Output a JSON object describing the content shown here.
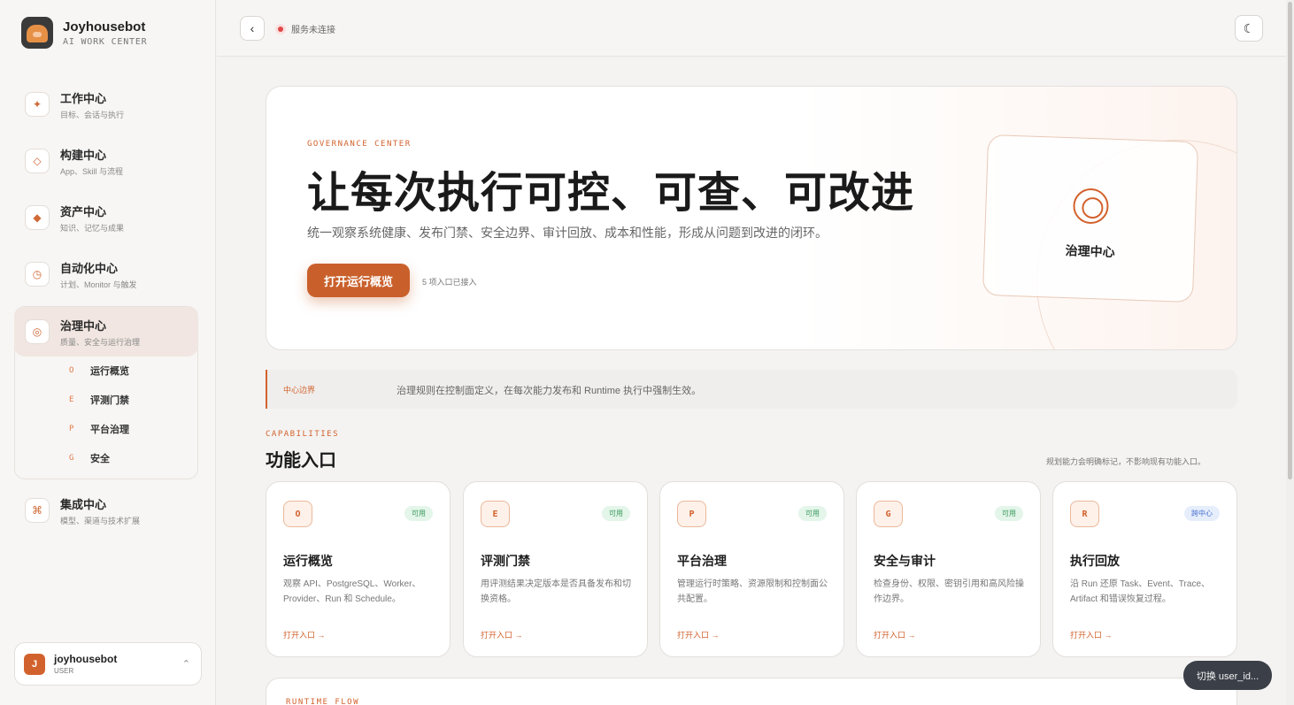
{
  "brand": {
    "name": "Joyhousebot",
    "subtitle": "AI WORK CENTER"
  },
  "sidebar": {
    "items": [
      {
        "title": "工作中心",
        "subtitle": "目标、会话与执行",
        "icon": "sparkle-icon",
        "glyph": "✦"
      },
      {
        "title": "构建中心",
        "subtitle": "App、Skill 与流程",
        "icon": "diamond-outline-icon",
        "glyph": "◇"
      },
      {
        "title": "资产中心",
        "subtitle": "知识、记忆与成果",
        "icon": "diamond-filled-icon",
        "glyph": "◆"
      },
      {
        "title": "自动化中心",
        "subtitle": "计划、Monitor 与触发",
        "icon": "clock-icon",
        "glyph": "◷"
      },
      {
        "title": "治理中心",
        "subtitle": "质量、安全与运行治理",
        "icon": "target-icon",
        "glyph": "◎"
      },
      {
        "title": "集成中心",
        "subtitle": "模型、渠道与技术扩展",
        "icon": "command-icon",
        "glyph": "⌘"
      }
    ],
    "subitems": [
      {
        "key": "O",
        "label": "运行概览"
      },
      {
        "key": "E",
        "label": "评测门禁"
      },
      {
        "key": "P",
        "label": "平台治理"
      },
      {
        "key": "G",
        "label": "安全"
      }
    ]
  },
  "user": {
    "initial": "J",
    "name": "joyhousebot",
    "role": "USER"
  },
  "topbar": {
    "status": "服务未连接",
    "status_color": "#e04848"
  },
  "hero": {
    "kicker": "GOVERNANCE CENTER",
    "title": "让每次执行可控、可查、可改进",
    "description": "统一观察系统健康、发布门禁、安全边界、审计回放、成本和性能，形成从问题到改进的闭环。",
    "button": "打开运行概览",
    "meta": "5 项入口已接入",
    "card_label": "治理中心"
  },
  "boundary": {
    "label": "中心边界",
    "text": "治理规则在控制面定义，在每次能力发布和 Runtime 执行中强制生效。"
  },
  "capabilities": {
    "kicker": "CAPABILITIES",
    "title": "功能入口",
    "note": "规划能力会明确标记，不影响现有功能入口。",
    "cards": [
      {
        "key": "O",
        "badge": "可用",
        "title": "运行概览",
        "description": "观察 API、PostgreSQL、Worker、Provider、Run 和 Schedule。",
        "link": "打开入口 →"
      },
      {
        "key": "E",
        "badge": "可用",
        "title": "评测门禁",
        "description": "用评测结果决定版本是否具备发布和切换资格。",
        "link": "打开入口 →"
      },
      {
        "key": "P",
        "badge": "可用",
        "title": "平台治理",
        "description": "管理运行时策略、资源限制和控制面公共配置。",
        "link": "打开入口 →"
      },
      {
        "key": "G",
        "badge": "可用",
        "title": "安全与审计",
        "description": "检查身份、权限、密钥引用和高风险操作边界。",
        "link": "打开入口 →"
      },
      {
        "key": "R",
        "badge": "跨中心",
        "title": "执行回放",
        "description": "沿 Run 还原 Task、Event、Trace、Artifact 和错误恢复过程。",
        "link": "打开入口 →"
      }
    ]
  },
  "runtime": {
    "kicker": "RUNTIME FLOW"
  },
  "toast": {
    "text": "切换 user_id..."
  },
  "colors": {
    "accent": "#d2622d",
    "available": "#3a9a5c",
    "cross_center": "#4a72d0"
  }
}
